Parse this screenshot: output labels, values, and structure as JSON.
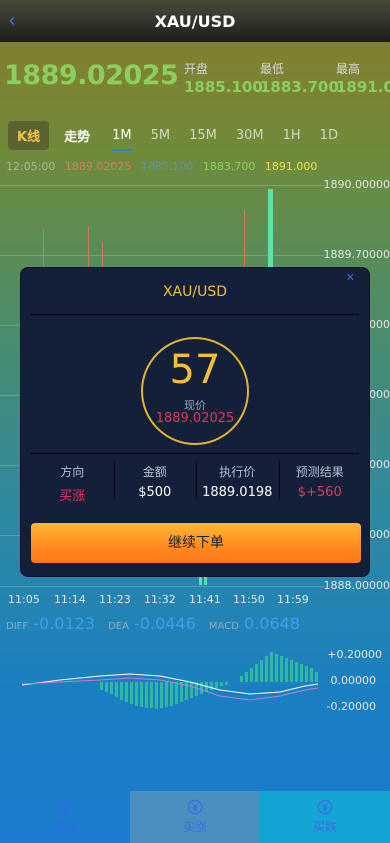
{
  "header": {
    "title": "XAU/USD",
    "back_icon": "chevron-left-icon"
  },
  "quote": {
    "price": "1889.02025",
    "open_label": "开盘",
    "low_label": "最低",
    "high_label": "最高",
    "open": "1885.100",
    "low": "1883.700",
    "high": "1891.0"
  },
  "tabs": [
    "K线",
    "走势",
    "1M",
    "5M",
    "15M",
    "30M",
    "1H",
    "1D"
  ],
  "active_tab": "1M",
  "chart_info": {
    "time": "12:05:00",
    "v1": "1889.02025",
    "v2": "1885.100",
    "v3": "1883.700",
    "v4": "1891.000"
  },
  "price_axis": [
    "1890.00000",
    "1889.70000",
    "1889.40000",
    "1889.10000",
    "1888.80000",
    "1888.50000",
    "1888.20000",
    "1888.00000"
  ],
  "time_axis": [
    "11:05",
    "11:14",
    "11:23",
    "11:32",
    "11:41",
    "11:50",
    "11:59"
  ],
  "indicators": {
    "diff_label": "DIFF",
    "diff": "-0.0123",
    "dea_label": "DEA",
    "dea": "-0.0446",
    "macd_label": "MACD",
    "macd": "0.0648"
  },
  "macd_axis": [
    "+0.20000",
    "0.00000",
    "-0.20000"
  ],
  "modal": {
    "title": "XAU/USD",
    "countdown": "57",
    "current_label": "现价",
    "current_price": "1889.02025",
    "direction_label": "方向",
    "direction": "买涨",
    "amount_label": "金额",
    "amount": "$500",
    "exec_label": "执行价",
    "exec_price": "1889.0198",
    "result_label": "预测结果",
    "result": "$+560",
    "continue_label": "继续下单",
    "close_icon": "close-icon"
  },
  "nav": {
    "hold": "持仓",
    "buy_up": "买涨",
    "buy_down": "买跌"
  },
  "colors": {
    "accent": "#f2c030",
    "up": "#e0385a",
    "green": "#8bd05f",
    "blue": "#3a6fe0"
  }
}
